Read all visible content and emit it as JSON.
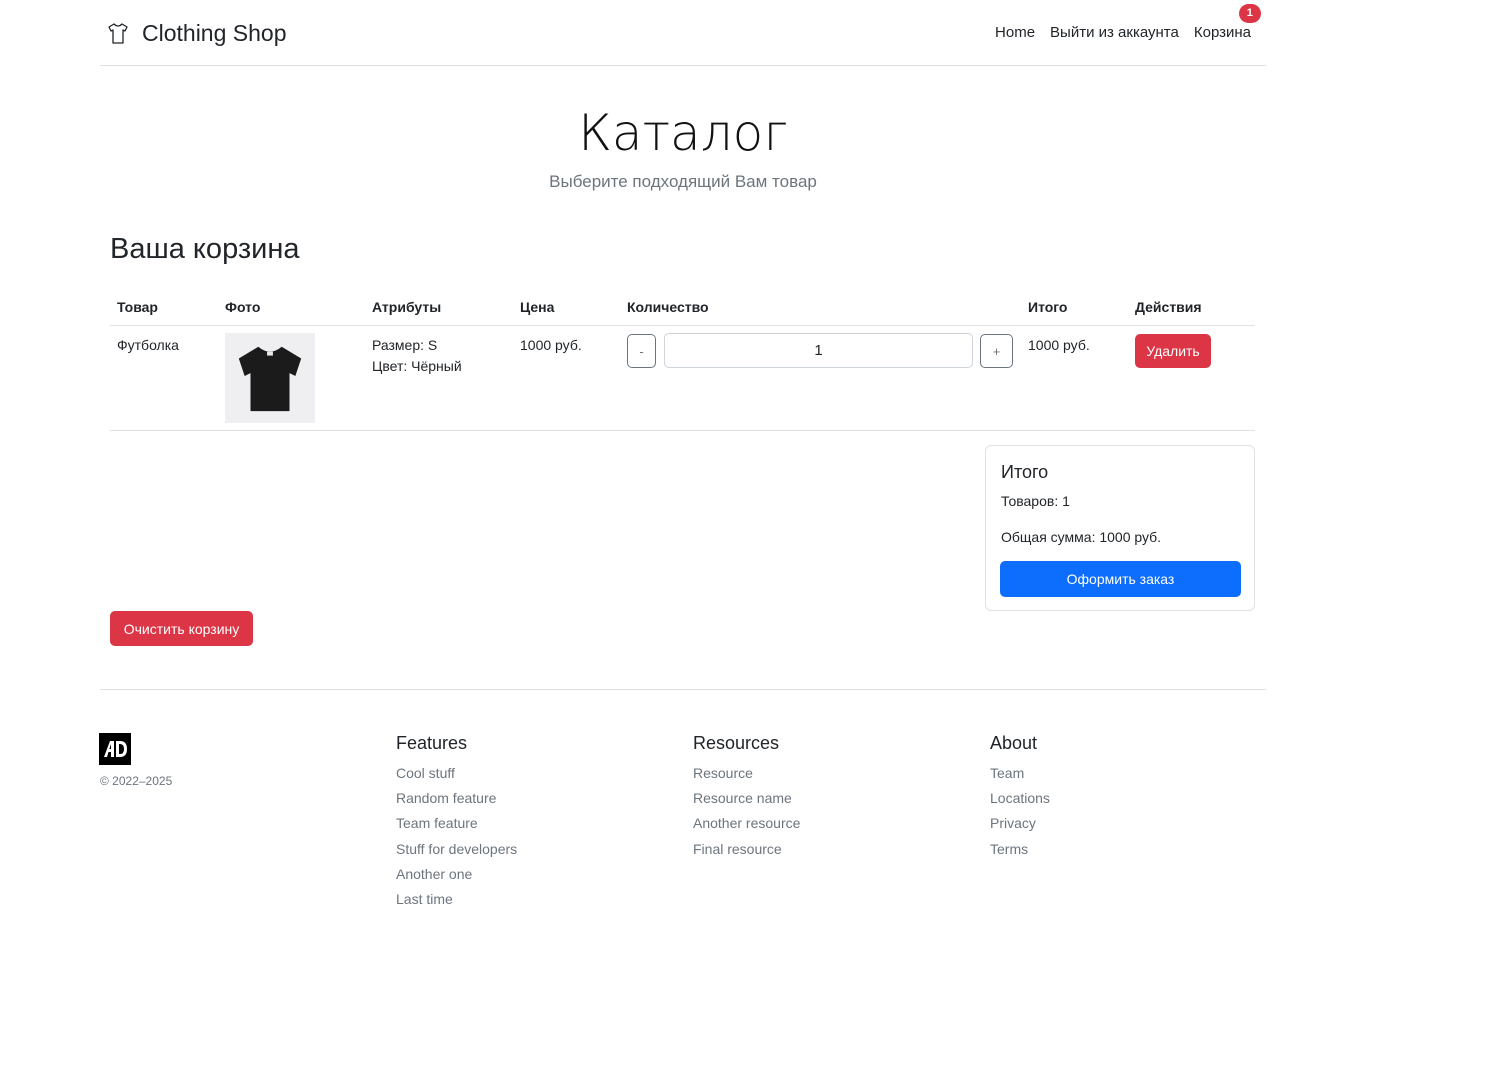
{
  "header": {
    "brand": "Clothing Shop",
    "nav": [
      {
        "label": "Home"
      },
      {
        "label": "Выйти из аккаунта"
      },
      {
        "label": "Корзина"
      }
    ],
    "cart_badge": "1"
  },
  "hero": {
    "title": "Каталог",
    "subtitle": "Выберите подходящий Вам товар"
  },
  "cart": {
    "title": "Ваша корзина",
    "columns": [
      "Товар",
      "Фото",
      "Атрибуты",
      "Цена",
      "Количество",
      "Итого",
      "Действия"
    ],
    "rows": [
      {
        "product": "Футболка",
        "attr_size": "Размер: S",
        "attr_color": "Цвет: Чёрный",
        "price": "1000 руб.",
        "minus": "-",
        "quantity": "1",
        "plus": "+",
        "total": "1000 руб.",
        "delete_label": "Удалить"
      }
    ],
    "clear_label": "Очистить корзину"
  },
  "summary": {
    "title": "Итого",
    "items_count": "Товаров: 1",
    "total_sum": "Общая сумма: 1000 руб.",
    "order_label": "Оформить заказ"
  },
  "footer": {
    "copyright": "© 2022–2025",
    "columns": [
      {
        "title": "Features",
        "links": [
          "Cool stuff",
          "Random feature",
          "Team feature",
          "Stuff for developers",
          "Another one",
          "Last time"
        ]
      },
      {
        "title": "Resources",
        "links": [
          "Resource",
          "Resource name",
          "Another resource",
          "Final resource"
        ]
      },
      {
        "title": "About",
        "links": [
          "Team",
          "Locations",
          "Privacy",
          "Terms"
        ]
      }
    ]
  },
  "colors": {
    "danger": "#dc3545",
    "primary": "#0d6efd",
    "muted": "#6c757d"
  }
}
